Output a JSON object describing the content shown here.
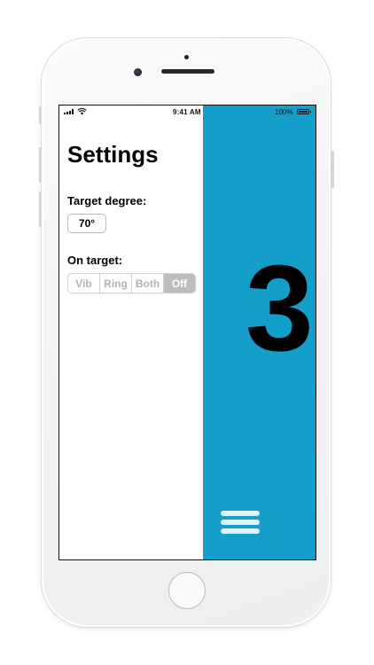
{
  "statusbar": {
    "time": "9:41 AM",
    "battery_percent": "100%"
  },
  "settings": {
    "title": "Settings",
    "target_degree_label": "Target degree:",
    "target_degree_value": "70°",
    "on_target_label": "On target:",
    "on_target_options": [
      "Vib",
      "Ring",
      "Both",
      "Off"
    ],
    "on_target_selected": "Off"
  },
  "main_panel": {
    "countdown": "3",
    "background_color": "#139fca"
  },
  "icons": {
    "menu": "hamburger-menu-icon",
    "signal": "cellular-signal-icon",
    "wifi": "wifi-icon",
    "battery": "battery-icon"
  }
}
